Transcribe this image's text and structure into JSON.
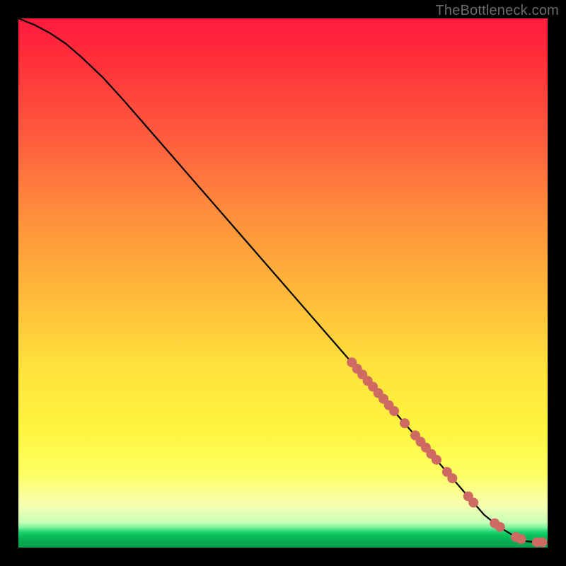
{
  "watermark": "TheBottleneck.com",
  "chart_data": {
    "type": "line",
    "title": "",
    "xlabel": "",
    "ylabel": "",
    "xlim": [
      0,
      100
    ],
    "ylim": [
      0,
      100
    ],
    "grid": false,
    "series": [
      {
        "name": "curve",
        "x": [
          0,
          3,
          6,
          9,
          12,
          16,
          20,
          24,
          28,
          32,
          36,
          40,
          44,
          48,
          52,
          56,
          60,
          64,
          68,
          72,
          76,
          80,
          84,
          88,
          90,
          92,
          94,
          96,
          98,
          100
        ],
        "y": [
          100,
          98.8,
          97.2,
          95.2,
          92.6,
          88.8,
          84.4,
          79.8,
          75.2,
          70.6,
          66.0,
          61.4,
          56.8,
          52.2,
          47.6,
          43.0,
          38.4,
          33.8,
          29.2,
          24.6,
          20.0,
          15.4,
          10.8,
          6.2,
          4.6,
          3.2,
          2.0,
          1.2,
          1.0,
          1.0
        ]
      }
    ],
    "markers": [
      {
        "x": 63,
        "y": 35.0
      },
      {
        "x": 64,
        "y": 33.8
      },
      {
        "x": 65,
        "y": 32.7
      },
      {
        "x": 66,
        "y": 31.5
      },
      {
        "x": 67,
        "y": 30.4
      },
      {
        "x": 68,
        "y": 29.2
      },
      {
        "x": 69,
        "y": 28.1
      },
      {
        "x": 70,
        "y": 26.9
      },
      {
        "x": 71,
        "y": 25.8
      },
      {
        "x": 73,
        "y": 23.5
      },
      {
        "x": 75,
        "y": 21.2
      },
      {
        "x": 76,
        "y": 20.0
      },
      {
        "x": 77,
        "y": 18.9
      },
      {
        "x": 78,
        "y": 17.7
      },
      {
        "x": 79,
        "y": 16.6
      },
      {
        "x": 81,
        "y": 14.3
      },
      {
        "x": 82,
        "y": 13.1
      },
      {
        "x": 85,
        "y": 9.7
      },
      {
        "x": 86,
        "y": 8.5
      },
      {
        "x": 90,
        "y": 4.6
      },
      {
        "x": 91,
        "y": 3.9
      },
      {
        "x": 94,
        "y": 2.0
      },
      {
        "x": 95,
        "y": 1.6
      },
      {
        "x": 98,
        "y": 1.0
      },
      {
        "x": 99,
        "y": 1.0
      }
    ],
    "colors": {
      "curve": "#000000",
      "marker_fill": "#cf6a63",
      "marker_stroke": "#cf6a63"
    }
  }
}
